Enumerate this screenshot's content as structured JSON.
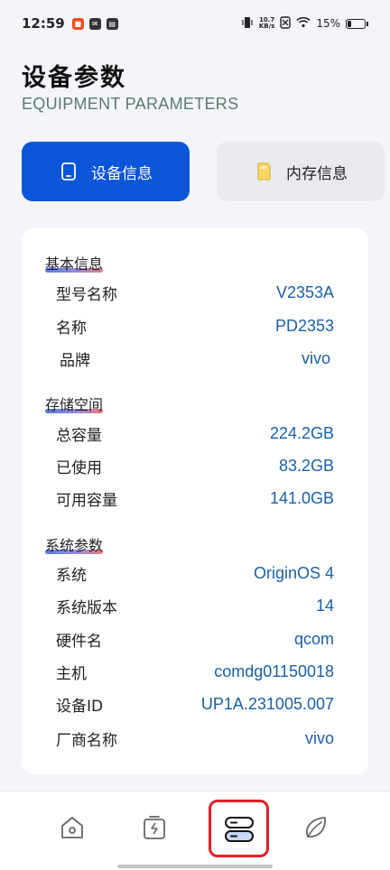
{
  "status_bar": {
    "time": "12:59",
    "net_speed_value": "10.7",
    "net_speed_unit": "KB/s",
    "battery": "15%"
  },
  "header": {
    "title": "设备参数",
    "subtitle": "EQUIPMENT PARAMETERS"
  },
  "tabs": [
    {
      "label": "设备信息",
      "icon": "tablet-icon",
      "active": true
    },
    {
      "label": "内存信息",
      "icon": "sd-card-icon",
      "active": false
    }
  ],
  "sections": {
    "basic": {
      "title": "基本信息",
      "rows": [
        {
          "label": "型号名称",
          "value": "V2353A"
        },
        {
          "label": "名称",
          "value": "PD2353"
        },
        {
          "label": "品牌",
          "value": "vivo"
        }
      ]
    },
    "storage": {
      "title": "存储空间",
      "rows": [
        {
          "label": "总容量",
          "value": "224.2GB"
        },
        {
          "label": "已使用",
          "value": "83.2GB"
        },
        {
          "label": "可用容量",
          "value": "141.0GB"
        }
      ]
    },
    "system": {
      "title": "系统参数",
      "rows": [
        {
          "label": "系统",
          "value": "OriginOS 4"
        },
        {
          "label": "系统版本",
          "value": "14"
        },
        {
          "label": "硬件名",
          "value": "qcom"
        },
        {
          "label": "主机",
          "value": "comdg01150018"
        },
        {
          "label": "设备ID",
          "value": "UP1A.231005.007"
        },
        {
          "label": "厂商名称",
          "value": "vivo"
        }
      ]
    }
  },
  "bottom_nav": [
    {
      "icon": "home-icon"
    },
    {
      "icon": "battery-charge-icon"
    },
    {
      "icon": "device-params-icon",
      "highlighted": true
    },
    {
      "icon": "leaf-icon"
    }
  ],
  "colors": {
    "accent": "#0b55d9",
    "value_text": "#1a5fa8",
    "highlight_box": "#e0202a",
    "background": "#f3f5fa"
  }
}
